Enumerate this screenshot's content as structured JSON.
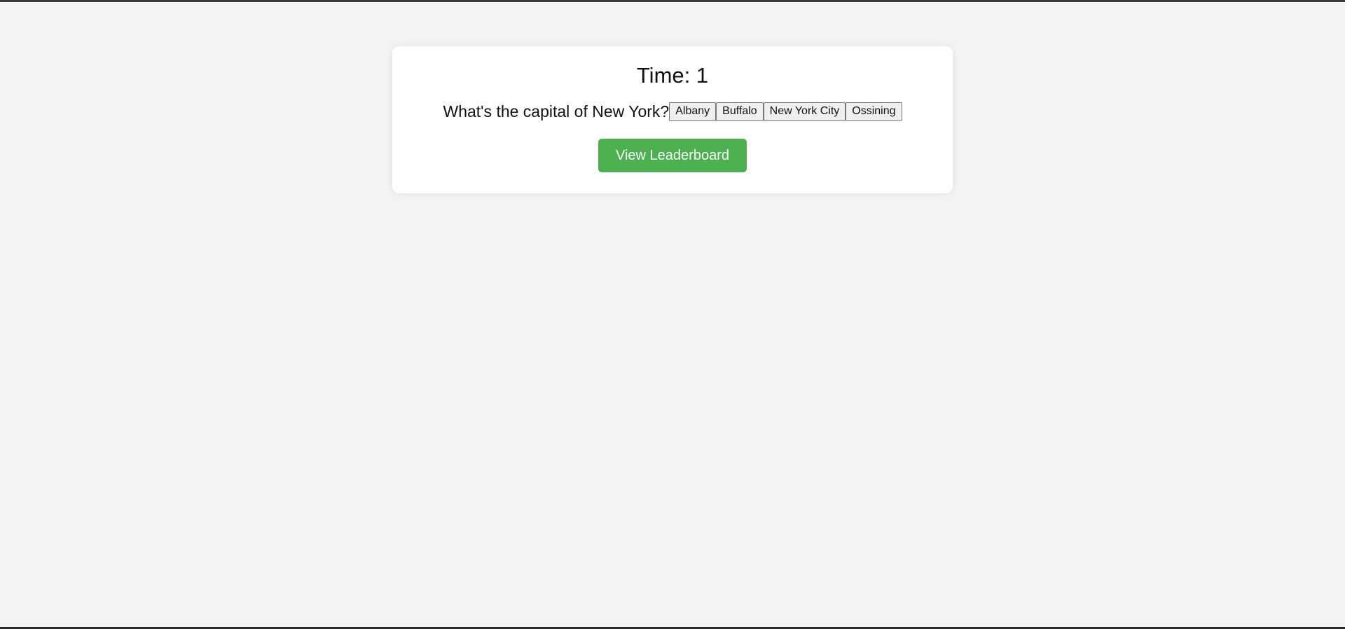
{
  "timer": {
    "label": "Time: 1"
  },
  "quiz": {
    "question": "What's the capital of New York?",
    "answers": [
      "Albany",
      "Buffalo",
      "New York City",
      "Ossining"
    ]
  },
  "actions": {
    "leaderboard_label": "View Leaderboard"
  },
  "colors": {
    "page_background": "#f3f3f3",
    "card_background": "#ffffff",
    "leaderboard_button": "#4caf50"
  }
}
